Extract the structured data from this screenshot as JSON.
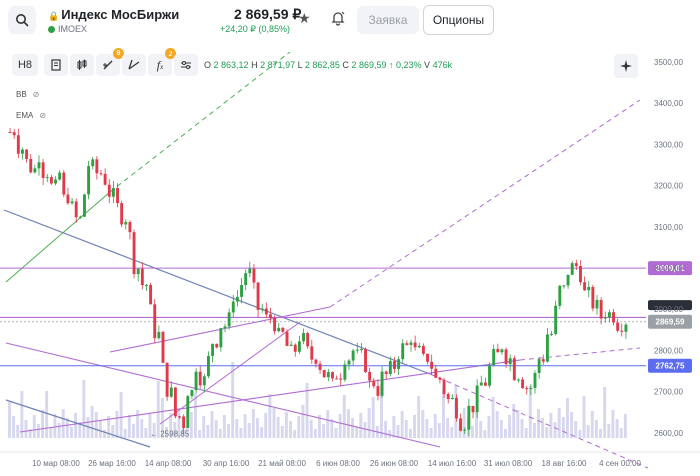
{
  "header": {
    "ticker_name": "Индекс МосБиржи",
    "ticker_code": "IMOEX",
    "price": "2 869,59 ₽",
    "change": "+24,20 ₽ (0,85%)",
    "order_label": "Заявка",
    "options_label": "Опционы"
  },
  "toolbar": {
    "interval_label": "H8",
    "drawings_badge": "9",
    "indicators_badge": "2",
    "ohlc": {
      "o_key": "O",
      "o": "2 863,12",
      "h_key": "H",
      "h": "2 871,97",
      "l_key": "L",
      "l": "2 862,85",
      "c_key": "C",
      "c": "2 869,59",
      "change": "↑ 0,23%",
      "v_key": "V",
      "v": "476k"
    }
  },
  "indicators": [
    {
      "label": "BB"
    },
    {
      "label": "EMA"
    }
  ],
  "colors": {
    "up": "#2ea043",
    "down": "#e03a4a",
    "purple": "#b26bd3",
    "blue": "#6d7fb8",
    "blueLevel": "#5b6cf0",
    "green": "#4caf50",
    "volume": "#c9cbe8"
  },
  "chart_data": {
    "type": "candlestick",
    "y_ticks": [
      "3500,00",
      "3400,00",
      "3300,00",
      "3200,00",
      "3100,00",
      "3000,00",
      "2900,00",
      "2800,00",
      "2700,00",
      "2600,00"
    ],
    "x_ticks": [
      "10 мар 08:00",
      "26 мар 16:00",
      "14 апр 08:00",
      "30 апр 16:00",
      "21 май 08:00",
      "6 июн 08:00",
      "26 июн 08:00",
      "14 июл 16:00",
      "31 июл 08:00",
      "18 авг 16:00",
      "4 сен 00:00"
    ],
    "price_tags": [
      {
        "label": "2999,81",
        "value": 2999.81,
        "color": "#b26bd3"
      },
      {
        "label": "2869,59",
        "value": 2869.59,
        "color": "#9aa0a6"
      },
      {
        "label": "2762,75",
        "value": 2762.75,
        "color": "#5b6cf0"
      }
    ],
    "low_annotation": "2598,85",
    "close_path": [
      3330,
      3290,
      3260,
      3240,
      3270,
      3230,
      3200,
      3230,
      3170,
      3150,
      3120,
      3180,
      3250,
      3230,
      3210,
      3180,
      3150,
      3120,
      3080,
      3000,
      2960,
      2900,
      2840,
      2760,
      2700,
      2640,
      2620,
      2700,
      2760,
      2730,
      2780,
      2820,
      2860,
      2880,
      2930,
      2960,
      2990,
      2950,
      2900,
      2880,
      2860,
      2840,
      2810,
      2800,
      2830,
      2800,
      2780,
      2760,
      2740,
      2720,
      2740,
      2780,
      2800,
      2790,
      2760,
      2720,
      2700,
      2740,
      2760,
      2790,
      2810,
      2830,
      2800,
      2780,
      2760,
      2730,
      2700,
      2680,
      2650,
      2620,
      2660,
      2700,
      2720,
      2760,
      2790,
      2810,
      2780,
      2740,
      2720,
      2710,
      2740,
      2780,
      2840,
      2900,
      2950,
      2990,
      3005,
      2980,
      2940,
      2910,
      2880,
      2890,
      2880,
      2860,
      2870
    ]
  }
}
